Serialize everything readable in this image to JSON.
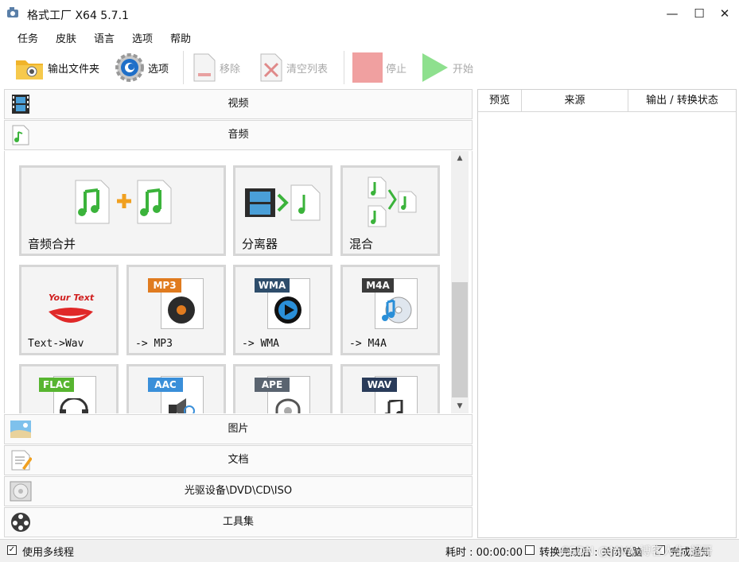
{
  "window": {
    "title": "格式工厂 X64 5.7.1",
    "min": "—",
    "max": "☐",
    "close": "✕"
  },
  "menu": [
    "任务",
    "皮肤",
    "语言",
    "选项",
    "帮助"
  ],
  "toolbar": {
    "output_folder": "输出文件夹",
    "options": "选项",
    "remove": "移除",
    "clear_list": "清空列表",
    "stop": "停止",
    "start": "开始"
  },
  "categories": {
    "video": "视频",
    "audio": "音频",
    "image": "图片",
    "document": "文档",
    "disc": "光驱设备\\DVD\\CD\\ISO",
    "tools": "工具集"
  },
  "audio_tiles": [
    {
      "label": "音频合并"
    },
    {
      "label": "分离器"
    },
    {
      "label": "混合"
    },
    {
      "label": "Text->Wav",
      "art_text": "Your Text"
    },
    {
      "label": "-> MP3",
      "badge": "MP3"
    },
    {
      "label": "-> WMA",
      "badge": "WMA"
    },
    {
      "label": "-> M4A",
      "badge": "M4A"
    },
    {
      "badge": "FLAC"
    },
    {
      "badge": "AAC"
    },
    {
      "badge": "APE"
    },
    {
      "badge": "WAV"
    }
  ],
  "task_list": {
    "columns": [
      "预览",
      "来源",
      "输出 / 转换状态"
    ]
  },
  "status": {
    "multithread": "使用多线程",
    "elapsed": "耗时 : 00:00:00",
    "after_convert": "转换完成后 : 关闭电脑",
    "notify": "完成通知"
  },
  "watermark": "CSDN @JAVA·博客人生 超哥",
  "colors": {
    "mp3": "#e07b1f",
    "wma": "#2e4d6b",
    "m4a": "#3b3b3b",
    "flac": "#57b530",
    "aac": "#3a8fd9",
    "ape": "#5a6470",
    "wav": "#2a3c5a",
    "stop": "#f0a0a0",
    "start": "#8ee08e"
  }
}
